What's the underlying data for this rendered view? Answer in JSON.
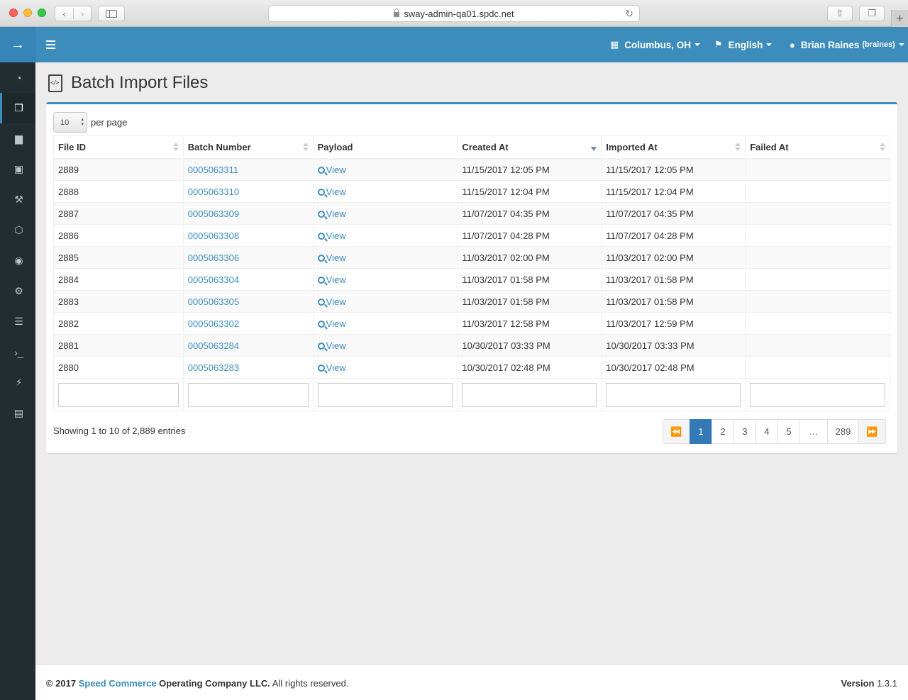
{
  "browser": {
    "url": "sway-admin-qa01.spdc.net",
    "back_glyph": "‹",
    "forward_glyph": "›",
    "reload_glyph": "↻",
    "share_glyph": "⇧",
    "tabs_glyph": "❐",
    "newtab_glyph": "+"
  },
  "sidebar": {
    "brand_icon": "→",
    "items": [
      {
        "icon": "dashboard-icon",
        "glyph": "◔"
      },
      {
        "icon": "files-icon",
        "glyph": "❐",
        "active": true
      },
      {
        "icon": "file-icon",
        "glyph": "▆"
      },
      {
        "icon": "medkit-icon",
        "glyph": "▣"
      },
      {
        "icon": "wrench-icon",
        "glyph": "⚒"
      },
      {
        "icon": "cube-icon",
        "glyph": "⬡"
      },
      {
        "icon": "user-circle-icon",
        "glyph": "◉"
      },
      {
        "icon": "gears-icon",
        "glyph": "⚙"
      },
      {
        "icon": "list-icon",
        "glyph": "☰"
      },
      {
        "icon": "terminal-icon",
        "glyph": "›_"
      },
      {
        "icon": "plug-icon",
        "glyph": "⚡"
      },
      {
        "icon": "server-icon",
        "glyph": "▤"
      }
    ]
  },
  "navbar": {
    "location": "Columbus, OH",
    "language": "English",
    "user_name": "Brian Raines",
    "user_handle": "(braines)",
    "location_glyph": "▦",
    "language_glyph": "⚑",
    "user_glyph": "●"
  },
  "page": {
    "title": "Batch Import Files"
  },
  "table": {
    "page_length": "10",
    "per_page_label": "per page",
    "columns": [
      "File ID",
      "Batch Number",
      "Payload",
      "Created At",
      "Imported At",
      "Failed At"
    ],
    "view_label": "View",
    "rows": [
      {
        "file_id": "2889",
        "batch": "0005063311",
        "created": "11/15/2017 12:05 PM",
        "imported": "11/15/2017 12:05 PM",
        "failed": ""
      },
      {
        "file_id": "2888",
        "batch": "0005063310",
        "created": "11/15/2017 12:04 PM",
        "imported": "11/15/2017 12:04 PM",
        "failed": ""
      },
      {
        "file_id": "2887",
        "batch": "0005063309",
        "created": "11/07/2017 04:35 PM",
        "imported": "11/07/2017 04:35 PM",
        "failed": ""
      },
      {
        "file_id": "2886",
        "batch": "0005063308",
        "created": "11/07/2017 04:28 PM",
        "imported": "11/07/2017 04:28 PM",
        "failed": ""
      },
      {
        "file_id": "2885",
        "batch": "0005063306",
        "created": "11/03/2017 02:00 PM",
        "imported": "11/03/2017 02:00 PM",
        "failed": ""
      },
      {
        "file_id": "2884",
        "batch": "0005063304",
        "created": "11/03/2017 01:58 PM",
        "imported": "11/03/2017 01:58 PM",
        "failed": ""
      },
      {
        "file_id": "2883",
        "batch": "0005063305",
        "created": "11/03/2017 01:58 PM",
        "imported": "11/03/2017 01:58 PM",
        "failed": ""
      },
      {
        "file_id": "2882",
        "batch": "0005063302",
        "created": "11/03/2017 12:58 PM",
        "imported": "11/03/2017 12:59 PM",
        "failed": ""
      },
      {
        "file_id": "2881",
        "batch": "0005063284",
        "created": "10/30/2017 03:33 PM",
        "imported": "10/30/2017 03:33 PM",
        "failed": ""
      },
      {
        "file_id": "2880",
        "batch": "0005063283",
        "created": "10/30/2017 02:48 PM",
        "imported": "10/30/2017 02:48 PM",
        "failed": ""
      }
    ],
    "info": "Showing 1 to 10 of 2,889 entries"
  },
  "pagination": {
    "first_glyph": "⏪",
    "last_glyph": "⏩",
    "pages": [
      "1",
      "2",
      "3",
      "4",
      "5",
      "…",
      "289"
    ],
    "active_page": "1"
  },
  "footer": {
    "copyright_prefix": "© 2017 ",
    "company_link": "Speed Commerce",
    "copyright_suffix": " Operating Company LLC.",
    "rights": " All rights reserved.",
    "version_label": "Version",
    "version": "1.3.1"
  },
  "colors": {
    "brand": "#3c8dbc",
    "sidebar_bg": "#222d32",
    "active_page": "#337ab7"
  }
}
